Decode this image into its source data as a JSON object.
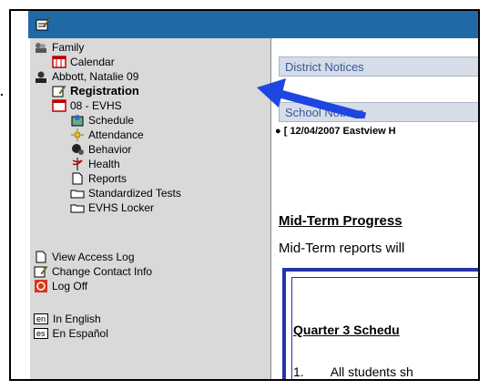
{
  "sidebar": {
    "family": "Family",
    "calendar": "Calendar",
    "student": "Abbott, Natalie 09",
    "registration": "Registration",
    "school": "08 - EVHS",
    "schedule": "Schedule",
    "attendance": "Attendance",
    "behavior": "Behavior",
    "health": "Health",
    "reports": "Reports",
    "tests": "Standardized Tests",
    "locker": "EVHS Locker",
    "view_log": "View Access Log",
    "contact": "Change Contact Info",
    "logoff": "Log Off",
    "lang_en_tag": "en",
    "lang_en": "In English",
    "lang_es_tag": "es",
    "lang_es": "En Español"
  },
  "main": {
    "district_notices": "District Notices",
    "school_notices": "School Notices",
    "notice_item": "[ 12/04/2007 Eastview H",
    "midterm_title": "Mid-Term Progress",
    "midterm_body": "Mid-Term reports will",
    "q3_title": "Quarter 3 Schedu",
    "q3_num": "1.",
    "q3_item": "All students sh"
  },
  "annotation": {
    "bullet": "."
  }
}
